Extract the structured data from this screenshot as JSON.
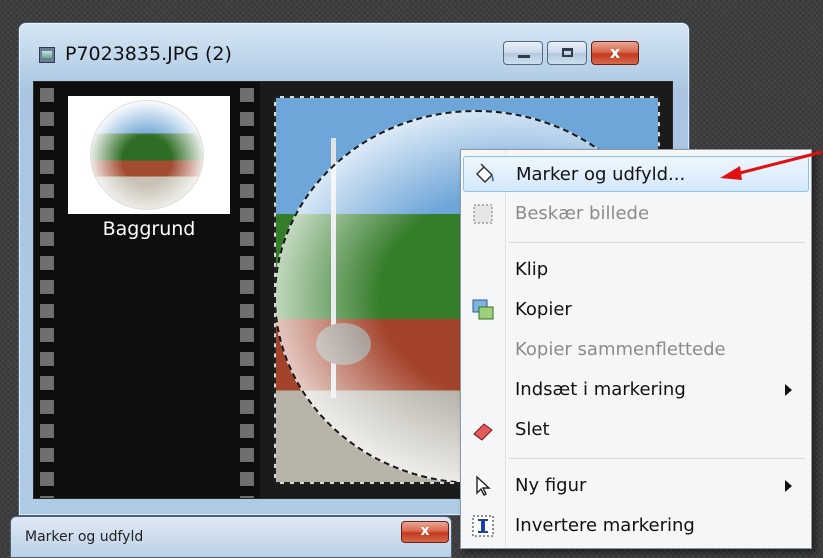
{
  "window": {
    "title": "P7023835.JPG (2)",
    "close_glyph": "x"
  },
  "layers": {
    "items": [
      {
        "label": "Baggrund"
      }
    ]
  },
  "context_menu": {
    "items": [
      {
        "label": "Marker og udfyld...",
        "icon": "paint-bucket-icon",
        "enabled": true,
        "highlighted": true
      },
      {
        "label": "Beskær billede",
        "icon": "crop-icon",
        "enabled": false
      },
      {
        "label": "Klip",
        "enabled": true
      },
      {
        "label": "Kopier",
        "icon": "copy-icon",
        "enabled": true
      },
      {
        "label": "Kopier sammenflettede",
        "enabled": false
      },
      {
        "label": "Indsæt i markering",
        "enabled": true,
        "submenu": true
      },
      {
        "label": "Slet",
        "icon": "eraser-icon",
        "enabled": true
      },
      {
        "label": "Ny figur",
        "icon": "pointer-icon",
        "enabled": true,
        "submenu": true
      },
      {
        "label": "Invertere markering",
        "icon": "invert-selection-icon",
        "enabled": true
      }
    ]
  },
  "sub_window": {
    "title": "Marker og udfyld",
    "close_glyph": "x"
  },
  "colors": {
    "annotation_arrow": "#e01010",
    "highlight": "#d4e8fb"
  }
}
